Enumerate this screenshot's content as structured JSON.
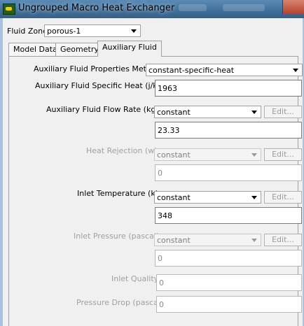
{
  "window": {
    "title": "Ungrouped Macro Heat Exchanger"
  },
  "header": {
    "fluid_zone_label": "Fluid Zone",
    "fluid_zone_value": "porous-1"
  },
  "tabs": [
    {
      "label": "Model Data"
    },
    {
      "label": "Geometry"
    },
    {
      "label": "Auxiliary Fluid"
    }
  ],
  "aux": {
    "properties_method": {
      "label": "Auxiliary Fluid Properties Method",
      "value": "constant-specific-heat"
    },
    "specific_heat": {
      "label": "Auxiliary Fluid Specific Heat (j/kg-k)",
      "value": "1963"
    },
    "flow_rate": {
      "label": "Auxiliary Fluid Flow Rate (kg/s)",
      "method": "constant",
      "edit": "Edit...",
      "value": "23.33"
    },
    "heat_rejection": {
      "label": "Heat Rejection (w)",
      "method": "constant",
      "edit": "Edit...",
      "value": "0"
    },
    "inlet_temperature": {
      "label": "Inlet Temperature (k)",
      "method": "constant",
      "edit": "Edit...",
      "value": "348"
    },
    "inlet_pressure": {
      "label": "Inlet Pressure (pascal)",
      "method": "constant",
      "edit": "Edit...",
      "value": "0"
    },
    "inlet_quality": {
      "label": "Inlet Quality",
      "value": "0"
    },
    "pressure_drop": {
      "label": "Pressure Drop (pascal)",
      "value": "0"
    }
  },
  "colors": {
    "titlebar": "#3f6f99",
    "disabled_text": "#a0a0a0"
  }
}
